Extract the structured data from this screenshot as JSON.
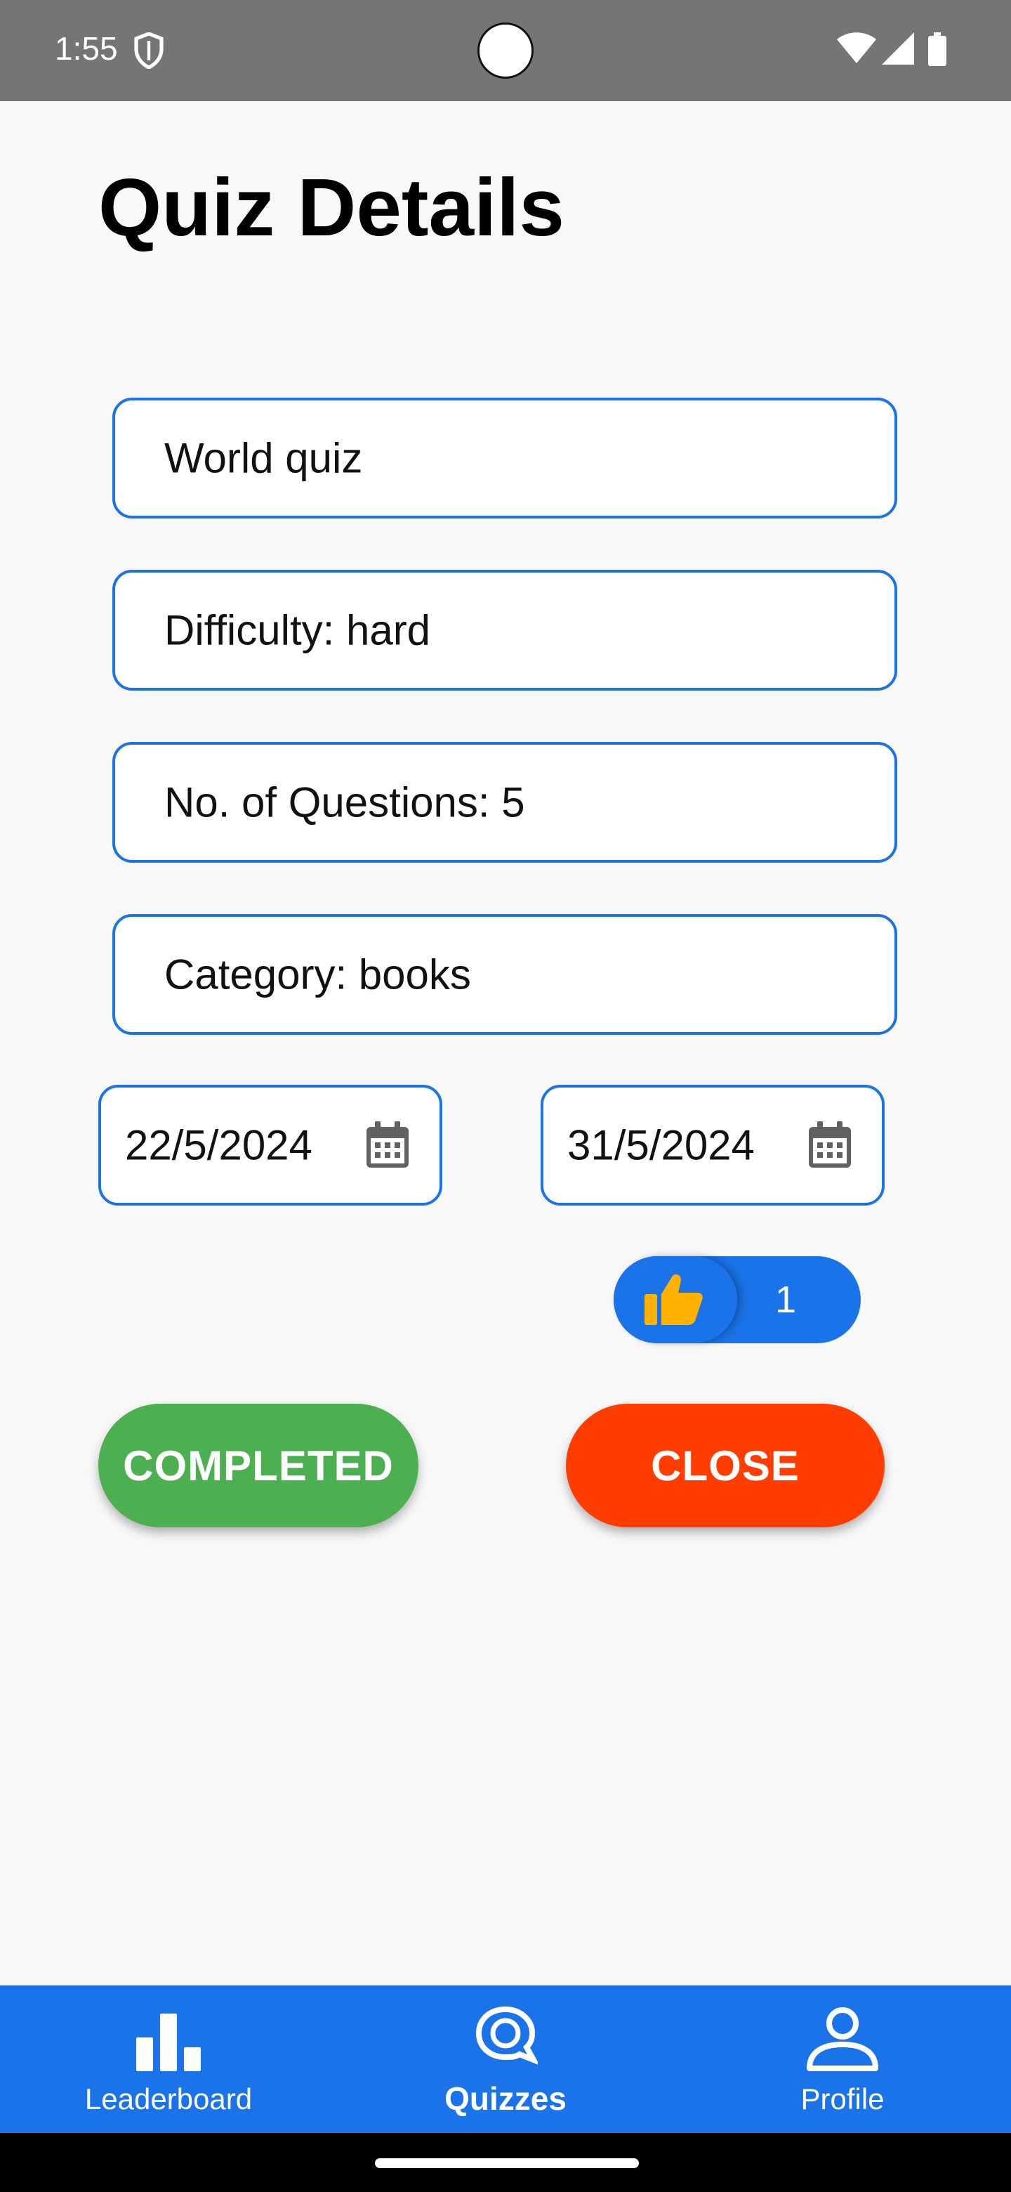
{
  "status": {
    "time": "1:55"
  },
  "page": {
    "title": "Quiz Details"
  },
  "fields": {
    "name": "World quiz",
    "difficulty": "Difficulty: hard",
    "questions": "No. of Questions: 5",
    "category": "Category: books"
  },
  "dates": {
    "start": "22/5/2024",
    "end": "31/5/2024"
  },
  "likes": {
    "count": "1"
  },
  "buttons": {
    "completed": "COMPLETED",
    "close": "CLOSE"
  },
  "nav": {
    "items": [
      {
        "label": "Leaderboard",
        "icon": "bar-chart-icon",
        "active": false
      },
      {
        "label": "Quizzes",
        "icon": "quiz-bubble-icon",
        "active": true
      },
      {
        "label": "Profile",
        "icon": "person-icon",
        "active": false
      }
    ]
  },
  "colors": {
    "primary": "#1a73e8",
    "completed": "#4caf50",
    "close": "#ff3d00",
    "thumb": "#ffb300",
    "status_bar": "#757575"
  }
}
